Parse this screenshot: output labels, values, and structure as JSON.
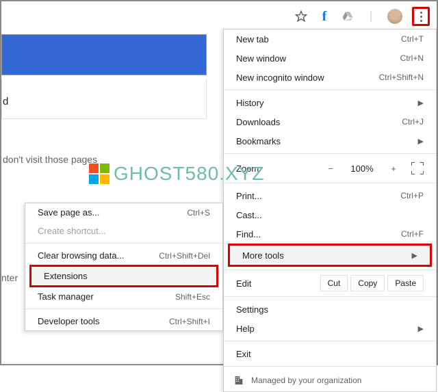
{
  "toolbar": {
    "star_title": "Bookmark this page",
    "facebook_letter": "f",
    "drive_title": "Google Drive",
    "avatar_title": "Profile",
    "menu_title": "Customize and control Google Chrome"
  },
  "partial": {
    "dchar": "d",
    "text_fragment": "don't visit those pages",
    "enter_fragment": "nter"
  },
  "menu": {
    "new_tab": {
      "label": "New tab",
      "shortcut": "Ctrl+T"
    },
    "new_window": {
      "label": "New window",
      "shortcut": "Ctrl+N"
    },
    "new_incognito": {
      "label": "New incognito window",
      "shortcut": "Ctrl+Shift+N"
    },
    "history": {
      "label": "History"
    },
    "downloads": {
      "label": "Downloads",
      "shortcut": "Ctrl+J"
    },
    "bookmarks": {
      "label": "Bookmarks"
    },
    "zoom": {
      "label": "Zoom",
      "minus": "−",
      "value": "100%",
      "plus": "+"
    },
    "print": {
      "label": "Print...",
      "shortcut": "Ctrl+P"
    },
    "cast": {
      "label": "Cast..."
    },
    "find": {
      "label": "Find...",
      "shortcut": "Ctrl+F"
    },
    "more_tools": {
      "label": "More tools"
    },
    "edit": {
      "label": "Edit",
      "cut": "Cut",
      "copy": "Copy",
      "paste": "Paste"
    },
    "settings": {
      "label": "Settings"
    },
    "help": {
      "label": "Help"
    },
    "exit": {
      "label": "Exit"
    },
    "managed": {
      "label": "Managed by your organization"
    }
  },
  "submenu": {
    "save_page": {
      "label": "Save page as...",
      "shortcut": "Ctrl+S"
    },
    "create_shortcut": {
      "label": "Create shortcut..."
    },
    "clear_browsing": {
      "label": "Clear browsing data...",
      "shortcut": "Ctrl+Shift+Del"
    },
    "extensions": {
      "label": "Extensions"
    },
    "task_manager": {
      "label": "Task manager",
      "shortcut": "Shift+Esc"
    },
    "dev_tools": {
      "label": "Developer tools",
      "shortcut": "Ctrl+Shift+I"
    }
  },
  "watermark": {
    "text": "GHOST580.XYZ"
  }
}
